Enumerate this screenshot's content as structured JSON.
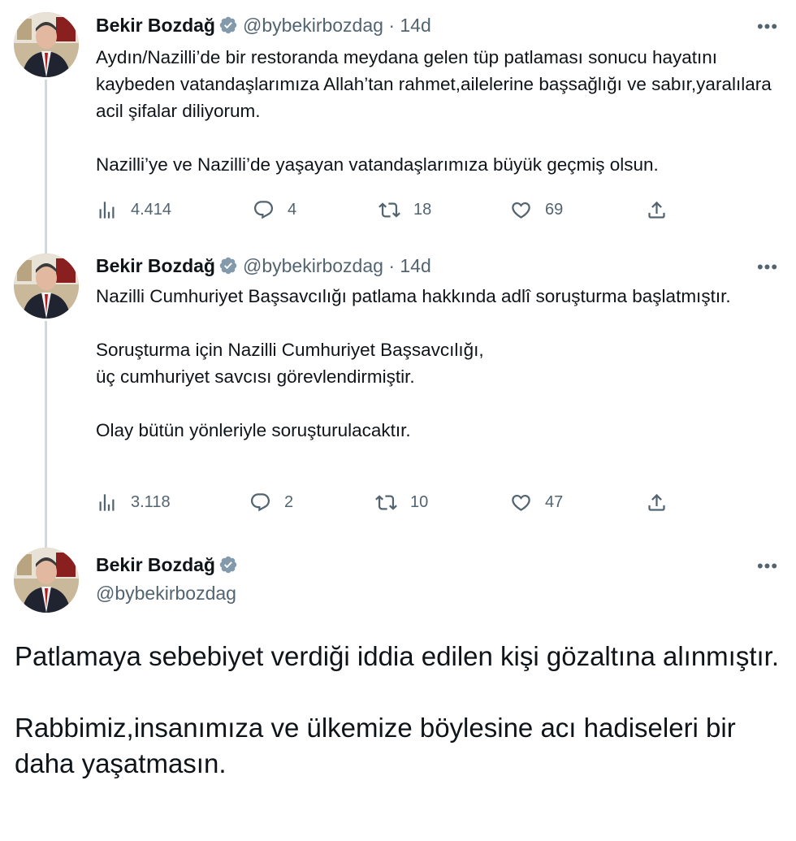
{
  "tweets": [
    {
      "name": "Bekir Bozdağ",
      "handle": "@bybekirbozdag",
      "time": "14d",
      "dot": "·",
      "text": "Aydın/Nazilli’de bir restoranda meydana gelen tüp patlaması sonucu hayatını kaybeden vatandaşlarımıza Allah’tan rahmet,ailelerine başsağlığı ve sabır,yaralılara acil şifalar diliyorum.\n\nNazilli’ye ve Nazilli’de yaşayan vatandaşlarımıza büyük geçmiş olsun.",
      "views": "4.414",
      "replies": "4",
      "retweets": "18",
      "likes": "69"
    },
    {
      "name": "Bekir Bozdağ",
      "handle": "@bybekirbozdag",
      "time": "14d",
      "dot": "·",
      "text": "Nazilli Cumhuriyet Başsavcılığı patlama hakkında adlî soruşturma başlatmıştır.\n\nSoruşturma için Nazilli Cumhuriyet Başsavcılığı,\nüç cumhuriyet savcısı görevlendirmiştir.\n\nOlay bütün yönleriyle soruşturulacaktır.",
      "views": "3.118",
      "replies": "2",
      "retweets": "10",
      "likes": "47"
    },
    {
      "name": "Bekir Bozdağ",
      "handle": "@bybekirbozdag",
      "text": "Patlamaya sebebiyet verdiği iddia edilen kişi gözaltına alınmıştır.\n\nRabbimiz,insanımıza ve ülkemize böylesine acı hadiseleri bir daha yaşatmasın."
    }
  ],
  "more_label": "•••",
  "icons": {
    "views": "views-icon",
    "reply": "reply-icon",
    "retweet": "retweet-icon",
    "like": "heart-icon",
    "share": "share-icon",
    "verified": "verified-badge-icon"
  },
  "colors": {
    "text": "#0f1419",
    "secondary": "#536471",
    "thread_line": "#cfd9de",
    "verified": "#829aab"
  }
}
